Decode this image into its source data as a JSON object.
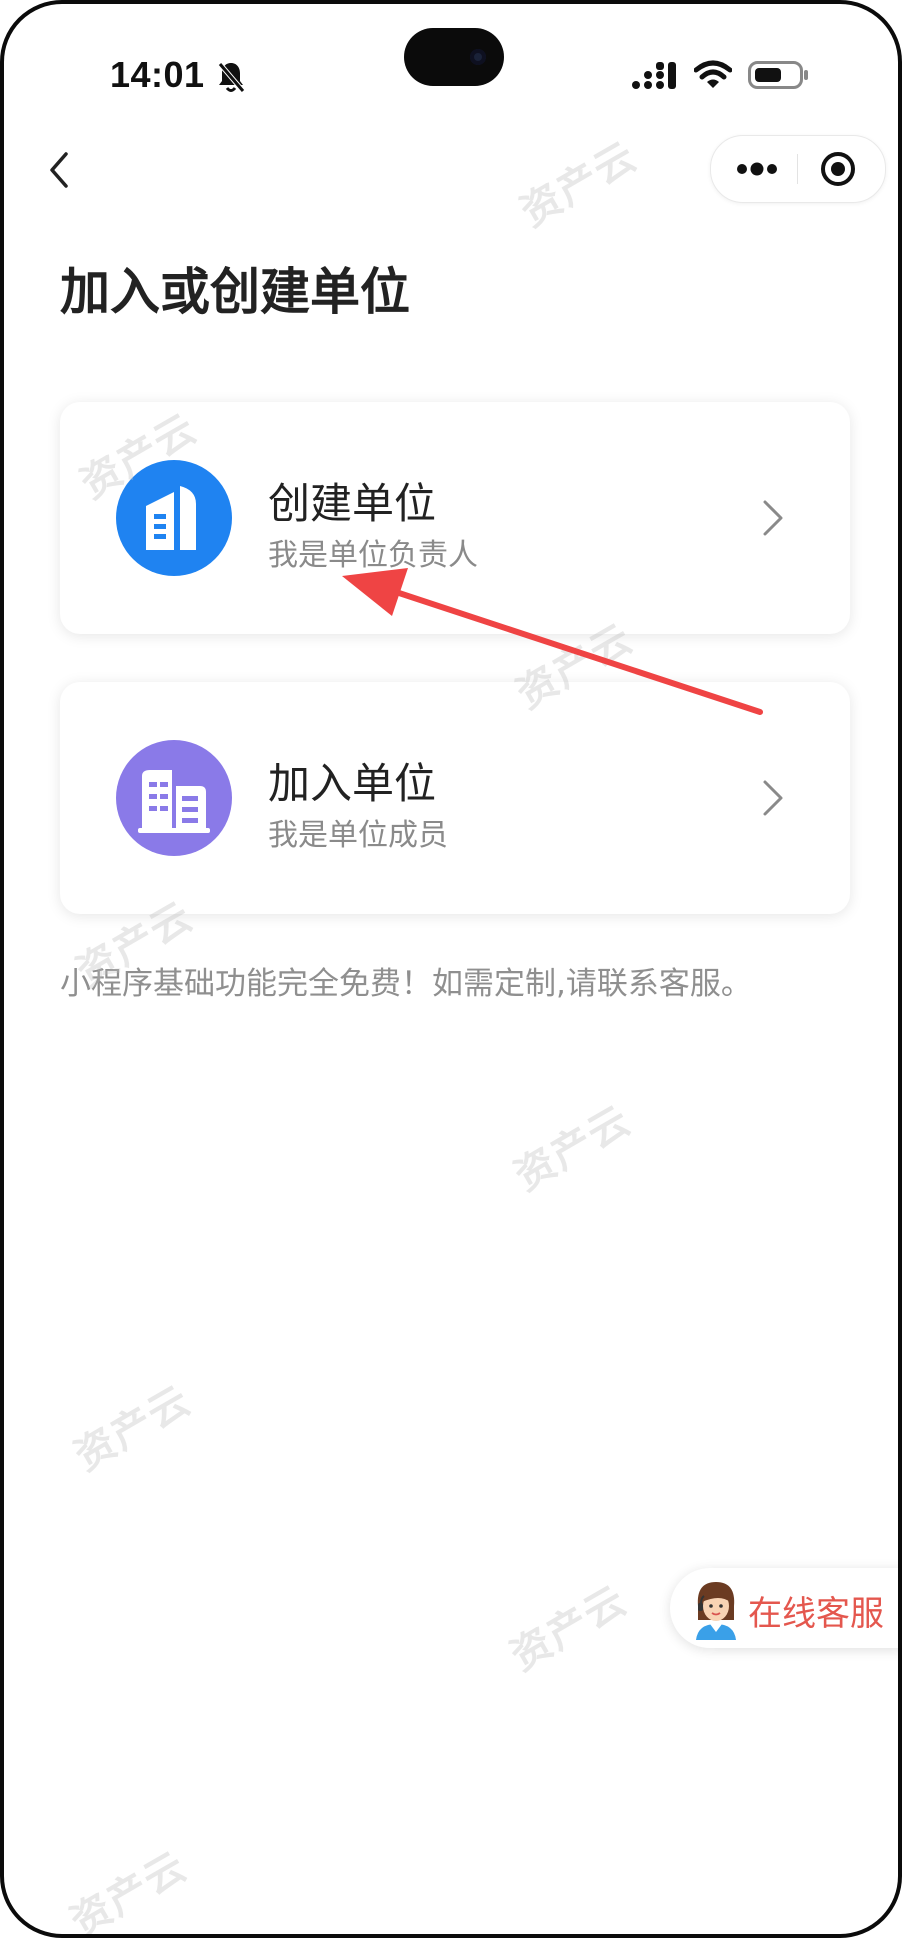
{
  "status_bar": {
    "time": "14:01"
  },
  "page": {
    "title": "加入或创建单位"
  },
  "cards": [
    {
      "title": "创建单位",
      "subtitle": "我是单位负责人",
      "icon": "office-building-icon",
      "color": "#1f83f1"
    },
    {
      "title": "加入单位",
      "subtitle": "我是单位成员",
      "icon": "buildings-icon",
      "color": "#8a7ae8"
    }
  ],
  "note": "小程序基础功能完全免费！如需定制,请联系客服。",
  "customer_service": {
    "label": "在线客服"
  },
  "watermark": {
    "text": "资产云"
  },
  "colors": {
    "accent_blue": "#1f83f1",
    "accent_purple": "#8a7ae8",
    "annotation_red": "#ef4444",
    "cs_text": "#e4574e"
  }
}
